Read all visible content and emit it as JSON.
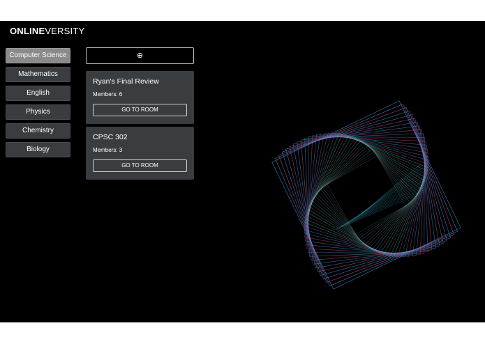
{
  "brand": {
    "logo_bold": "ONLINE",
    "logo_light": "VERSITY"
  },
  "sidebar": {
    "items": [
      {
        "label": "Computer Science",
        "active": true
      },
      {
        "label": "Mathematics",
        "active": false
      },
      {
        "label": "English",
        "active": false
      },
      {
        "label": "Physics",
        "active": false
      },
      {
        "label": "Chemistry",
        "active": false
      },
      {
        "label": "Biology",
        "active": false
      }
    ]
  },
  "rooms": {
    "add_icon": "⊕",
    "list": [
      {
        "title": "Ryan's Final Review",
        "members": "Members: 6",
        "button": "GO TO ROOM"
      },
      {
        "title": "CPSC 302",
        "members": "Members: 3",
        "button": "GO TO ROOM"
      }
    ]
  },
  "colors": {
    "background": "#000000",
    "card": "#3a3d40",
    "active_subject": "#8a8a8a",
    "art_primary": "#4a8fd9",
    "art_secondary": "#3fd9c2",
    "art_accent": "#d84f7a"
  }
}
